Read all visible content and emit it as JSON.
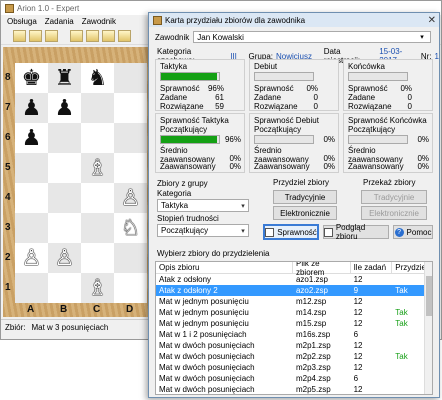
{
  "main": {
    "title": "Arion 1.0 - Expert",
    "menu": [
      "Obsługa",
      "Zadania",
      "Zawodnik"
    ],
    "ranks": [
      "8",
      "7",
      "6",
      "5",
      "4",
      "3",
      "2",
      "1"
    ],
    "files": [
      "A",
      "B",
      "C",
      "D"
    ],
    "status_label": "Zbiór:",
    "status_value": "Mat w 3 posunięciach",
    "pieces": [
      {
        "sq": "a8",
        "glyph": "♚",
        "color": "b"
      },
      {
        "sq": "b8",
        "glyph": "♜",
        "color": "b"
      },
      {
        "sq": "c8",
        "glyph": "♞",
        "color": "b"
      },
      {
        "sq": "a7",
        "glyph": "♟",
        "color": "b"
      },
      {
        "sq": "b7",
        "glyph": "♟",
        "color": "b"
      },
      {
        "sq": "a6",
        "glyph": "♟",
        "color": "b"
      },
      {
        "sq": "c5",
        "glyph": "♗",
        "color": "w"
      },
      {
        "sq": "d4",
        "glyph": "♙",
        "color": "w"
      },
      {
        "sq": "d3",
        "glyph": "♘",
        "color": "w"
      },
      {
        "sq": "a2",
        "glyph": "♙",
        "color": "w"
      },
      {
        "sq": "b2",
        "glyph": "♙",
        "color": "w"
      },
      {
        "sq": "c1",
        "glyph": "♗",
        "color": "w"
      }
    ]
  },
  "dialog": {
    "title": "Karta przydziału zbiorów dla zawodnika",
    "zawodnik_label": "Zawodnik",
    "zawodnik_value": "Jan Kowalski",
    "kategoria_label": "Kategoria szachowa:",
    "kategoria_value": "III",
    "grupa_label": "Grupa:",
    "grupa_value": "Nowicjusz",
    "rejestracja_label": "Data rejestracji:",
    "rejestracja_value": "15-03-2017",
    "nr_label": "Nr:",
    "nr_value": "1",
    "sections": [
      {
        "name": "Taktyka",
        "progress_pct": 96,
        "sprawnosc": "96%",
        "zadane": "61",
        "rozwiazane": "59"
      },
      {
        "name": "Debiut",
        "progress_pct": 0,
        "sprawnosc": "0%",
        "zadane": "0",
        "rozwiazane": "0"
      },
      {
        "name": "Końcówka",
        "progress_pct": 0,
        "sprawnosc": "0%",
        "zadane": "0",
        "rozwiazane": "0"
      }
    ],
    "stat_labels": {
      "sprawnosc": "Sprawność",
      "zadane": "Zadane",
      "rozwiazane": "Rozwiązane"
    },
    "sub_sections": [
      {
        "title": "Sprawność Taktyka",
        "level": "Początkujący",
        "progress_pct": 96,
        "value": "96%",
        "srednio": "0%",
        "zaawansowany": "0%"
      },
      {
        "title": "Sprawność Debiut",
        "level": "Początkujący",
        "progress_pct": 0,
        "value": "0%",
        "srednio": "0%",
        "zaawansowany": "0%"
      },
      {
        "title": "Sprawność Końcówka",
        "level": "Początkujący",
        "progress_pct": 0,
        "value": "0%",
        "srednio": "0%",
        "zaawansowany": "0%"
      }
    ],
    "sub_labels": {
      "srednio": "Średnio zaawansowany",
      "zaawansowany": "Zaawansowany"
    },
    "grupy_title": "Zbiory z grupy",
    "kategoria_select_label": "Kategoria",
    "kategoria_select_value": "Taktyka",
    "stopien_label": "Stopień trudności",
    "stopien_value": "Początkujący",
    "przydziel_title": "Przydziel zbiory",
    "btn_tradycyjnie": "Tradycyjnie",
    "btn_elektronicznie": "Elektronicznie",
    "przekaz_title": "Przekaż zbiory",
    "btn_tradycyjnie2": "Tradycyjnie",
    "btn_elektronicznie2": "Elektronicznie",
    "btn_sprawnosc": "Sprawność",
    "btn_podglad": "Podgląd zbioru",
    "btn_pomoc": "Pomoc",
    "wybierz_label": "Wybierz zbiory do przydzielenia",
    "table_headers": [
      "Opis zbioru",
      "Plik ze zbiorem",
      "Ile zadań",
      "Przydziel"
    ],
    "rows": [
      {
        "opis": "Atak z odsłony",
        "plik": "azo1.zsp",
        "ile": "12",
        "przydziel": "",
        "selected": false
      },
      {
        "opis": "Atak z odsłony 2",
        "plik": "azo2.zsp",
        "ile": "9",
        "przydziel": "Tak",
        "selected": true
      },
      {
        "opis": "Mat w jednym posunięciu",
        "plik": "m12.zsp",
        "ile": "12",
        "przydziel": "",
        "selected": false
      },
      {
        "opis": "Mat w jednym posunięciu",
        "plik": "m14.zsp",
        "ile": "12",
        "przydziel": "Tak",
        "selected": false
      },
      {
        "opis": "Mat w jednym posunięciu",
        "plik": "m15.zsp",
        "ile": "12",
        "przydziel": "Tak",
        "selected": false
      },
      {
        "opis": "Mat w 1 i 2 posunięciach",
        "plik": "m16s.zsp",
        "ile": "6",
        "przydziel": "",
        "selected": false
      },
      {
        "opis": "Mat w dwóch posunięciach",
        "plik": "m2p1.zsp",
        "ile": "12",
        "przydziel": "",
        "selected": false
      },
      {
        "opis": "Mat w dwóch posunięciach",
        "plik": "m2p2.zsp",
        "ile": "12",
        "przydziel": "Tak",
        "selected": false
      },
      {
        "opis": "Mat w dwóch posunięciach",
        "plik": "m2p3.zsp",
        "ile": "12",
        "przydziel": "",
        "selected": false
      },
      {
        "opis": "Mat w dwóch posunięciach",
        "plik": "m2p4.zsp",
        "ile": "6",
        "przydziel": "",
        "selected": false
      },
      {
        "opis": "Mat w dwóch posunięciach",
        "plik": "m2p5.zsp",
        "ile": "12",
        "przydziel": "",
        "selected": false
      }
    ]
  }
}
